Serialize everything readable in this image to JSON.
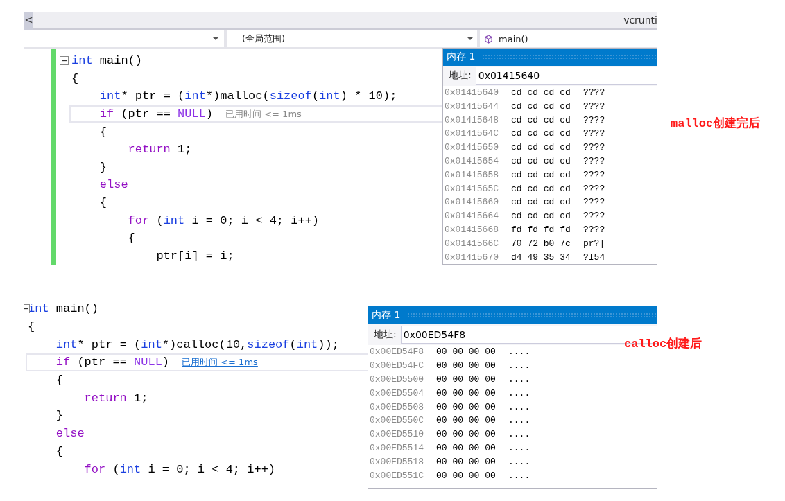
{
  "captures": [
    {
      "tab_bar": {
        "scroll_button": "<",
        "tab": "vcrunti"
      },
      "nav_bar": {
        "scope": "(全局范围)",
        "function": "main()"
      },
      "editor": {
        "change_bar": true,
        "lines": [
          {
            "fold_marker": true,
            "current": false,
            "tokens": [
              {
                "kind": "type",
                "text": "int"
              },
              {
                "kind": "plain",
                "text": " main()"
              }
            ]
          },
          {
            "fold_marker": false,
            "current": false,
            "tokens": [
              {
                "kind": "plain",
                "text": "{"
              }
            ]
          },
          {
            "fold_marker": false,
            "current": false,
            "tokens": [
              {
                "kind": "type",
                "text": "    int"
              },
              {
                "kind": "plain",
                "text": "* ptr = ("
              },
              {
                "kind": "type",
                "text": "int"
              },
              {
                "kind": "plain",
                "text": "*)malloc("
              },
              {
                "kind": "type",
                "text": "sizeof"
              },
              {
                "kind": "plain",
                "text": "("
              },
              {
                "kind": "type",
                "text": "int"
              },
              {
                "kind": "plain",
                "text": ") * 10);"
              }
            ]
          },
          {
            "fold_marker": false,
            "current": true,
            "hint": {
              "text": "已用时间 <= 1ms",
              "link": false
            },
            "tokens": [
              {
                "kind": "keyword",
                "text": "    if"
              },
              {
                "kind": "plain",
                "text": " (ptr == "
              },
              {
                "kind": "macro",
                "text": "NULL"
              },
              {
                "kind": "plain",
                "text": ")"
              }
            ]
          },
          {
            "fold_marker": false,
            "current": false,
            "tokens": [
              {
                "kind": "plain",
                "text": "    {"
              }
            ]
          },
          {
            "fold_marker": false,
            "current": false,
            "tokens": [
              {
                "kind": "keyword",
                "text": "        return"
              },
              {
                "kind": "plain",
                "text": " 1;"
              }
            ]
          },
          {
            "fold_marker": false,
            "current": false,
            "tokens": [
              {
                "kind": "plain",
                "text": "    }"
              }
            ]
          },
          {
            "fold_marker": false,
            "current": false,
            "tokens": [
              {
                "kind": "keyword",
                "text": "    else"
              }
            ]
          },
          {
            "fold_marker": false,
            "current": false,
            "tokens": [
              {
                "kind": "plain",
                "text": "    {"
              }
            ]
          },
          {
            "fold_marker": false,
            "current": false,
            "tokens": [
              {
                "kind": "keyword",
                "text": "        for"
              },
              {
                "kind": "plain",
                "text": " ("
              },
              {
                "kind": "type",
                "text": "int"
              },
              {
                "kind": "plain",
                "text": " i = 0; i < 4; i++)"
              }
            ]
          },
          {
            "fold_marker": false,
            "current": false,
            "tokens": [
              {
                "kind": "plain",
                "text": "        {"
              }
            ]
          },
          {
            "fold_marker": false,
            "current": false,
            "tokens": [
              {
                "kind": "plain",
                "text": "            ptr[i] = i;"
              }
            ]
          }
        ]
      },
      "memory_window": {
        "title": "内存 1",
        "address_label": "地址:",
        "address": "0x01415640",
        "rows": [
          {
            "address": "0x01415640",
            "bytes": "cd cd cd cd",
            "text": "????"
          },
          {
            "address": "0x01415644",
            "bytes": "cd cd cd cd",
            "text": "????"
          },
          {
            "address": "0x01415648",
            "bytes": "cd cd cd cd",
            "text": "????"
          },
          {
            "address": "0x0141564C",
            "bytes": "cd cd cd cd",
            "text": "????"
          },
          {
            "address": "0x01415650",
            "bytes": "cd cd cd cd",
            "text": "????"
          },
          {
            "address": "0x01415654",
            "bytes": "cd cd cd cd",
            "text": "????"
          },
          {
            "address": "0x01415658",
            "bytes": "cd cd cd cd",
            "text": "????"
          },
          {
            "address": "0x0141565C",
            "bytes": "cd cd cd cd",
            "text": "????"
          },
          {
            "address": "0x01415660",
            "bytes": "cd cd cd cd",
            "text": "????"
          },
          {
            "address": "0x01415664",
            "bytes": "cd cd cd cd",
            "text": "????"
          },
          {
            "address": "0x01415668",
            "bytes": "fd fd fd fd",
            "text": "????"
          },
          {
            "address": "0x0141566C",
            "bytes": "70 72 b0 7c",
            "text": "pr?|"
          },
          {
            "address": "0x01415670",
            "bytes": "d4 49 35 34",
            "text": "?I54"
          }
        ]
      }
    },
    {
      "editor": {
        "change_bar": false,
        "lines": [
          {
            "fold_marker": true,
            "current": false,
            "tokens": [
              {
                "kind": "type",
                "text": "int"
              },
              {
                "kind": "plain",
                "text": " main()"
              }
            ]
          },
          {
            "fold_marker": false,
            "current": false,
            "tokens": [
              {
                "kind": "plain",
                "text": "{"
              }
            ]
          },
          {
            "fold_marker": false,
            "current": false,
            "tokens": [
              {
                "kind": "type",
                "text": "    int"
              },
              {
                "kind": "plain",
                "text": "* ptr = ("
              },
              {
                "kind": "type",
                "text": "int"
              },
              {
                "kind": "plain",
                "text": "*)calloc(10,"
              },
              {
                "kind": "type",
                "text": "sizeof"
              },
              {
                "kind": "plain",
                "text": "("
              },
              {
                "kind": "type",
                "text": "int"
              },
              {
                "kind": "plain",
                "text": "));"
              }
            ]
          },
          {
            "fold_marker": false,
            "current": true,
            "hint": {
              "text": "已用时间 <= 1ms",
              "link": true
            },
            "tokens": [
              {
                "kind": "keyword",
                "text": "    if"
              },
              {
                "kind": "plain",
                "text": " (ptr == "
              },
              {
                "kind": "macro",
                "text": "NULL"
              },
              {
                "kind": "plain",
                "text": ")"
              }
            ]
          },
          {
            "fold_marker": false,
            "current": false,
            "tokens": [
              {
                "kind": "plain",
                "text": "    {"
              }
            ]
          },
          {
            "fold_marker": false,
            "current": false,
            "tokens": [
              {
                "kind": "keyword",
                "text": "        return"
              },
              {
                "kind": "plain",
                "text": " 1;"
              }
            ]
          },
          {
            "fold_marker": false,
            "current": false,
            "tokens": [
              {
                "kind": "plain",
                "text": "    }"
              }
            ]
          },
          {
            "fold_marker": false,
            "current": false,
            "tokens": [
              {
                "kind": "keyword",
                "text": "    else"
              }
            ]
          },
          {
            "fold_marker": false,
            "current": false,
            "tokens": [
              {
                "kind": "plain",
                "text": "    {"
              }
            ]
          },
          {
            "fold_marker": false,
            "current": false,
            "tokens": [
              {
                "kind": "keyword",
                "text": "        for"
              },
              {
                "kind": "plain",
                "text": " ("
              },
              {
                "kind": "type",
                "text": "int"
              },
              {
                "kind": "plain",
                "text": " i = 0; i < 4; i++)"
              }
            ]
          }
        ]
      },
      "memory_window": {
        "title": "内存 1",
        "address_label": "地址:",
        "address": "0x00ED54F8",
        "rows": [
          {
            "address": "0x00ED54F8",
            "bytes": "00 00 00 00",
            "text": "...."
          },
          {
            "address": "0x00ED54FC",
            "bytes": "00 00 00 00",
            "text": "...."
          },
          {
            "address": "0x00ED5500",
            "bytes": "00 00 00 00",
            "text": "...."
          },
          {
            "address": "0x00ED5504",
            "bytes": "00 00 00 00",
            "text": "...."
          },
          {
            "address": "0x00ED5508",
            "bytes": "00 00 00 00",
            "text": "...."
          },
          {
            "address": "0x00ED550C",
            "bytes": "00 00 00 00",
            "text": "...."
          },
          {
            "address": "0x00ED5510",
            "bytes": "00 00 00 00",
            "text": "...."
          },
          {
            "address": "0x00ED5514",
            "bytes": "00 00 00 00",
            "text": "...."
          },
          {
            "address": "0x00ED5518",
            "bytes": "00 00 00 00",
            "text": "...."
          },
          {
            "address": "0x00ED551C",
            "bytes": "00 00 00 00",
            "text": "...."
          }
        ]
      }
    }
  ],
  "annotations": [
    {
      "text": "malloc创建完后"
    },
    {
      "text": "calloc创建后"
    }
  ]
}
